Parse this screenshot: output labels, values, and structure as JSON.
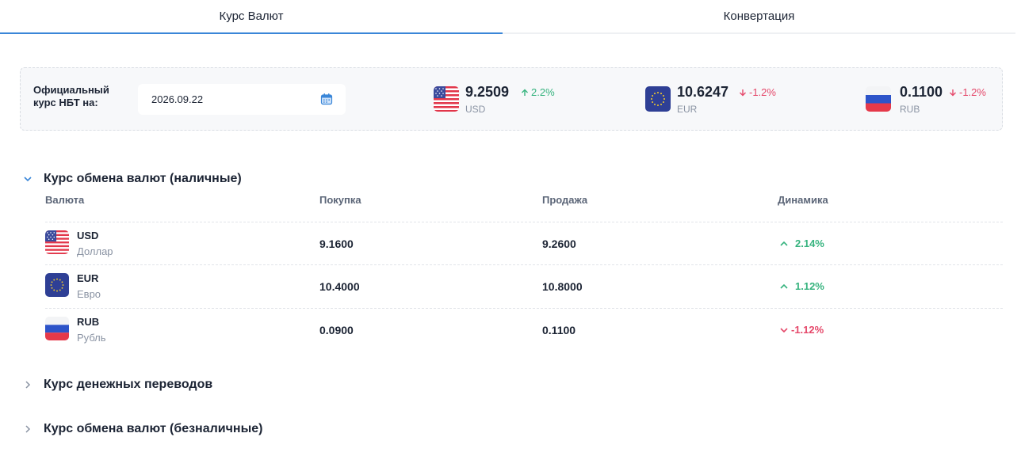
{
  "tabs": [
    {
      "label": "Курс Валют",
      "active": true
    },
    {
      "label": "Конвертация",
      "active": false
    }
  ],
  "official": {
    "label": "Официальный курс НБТ на:",
    "date": "2026.09.22",
    "date_icon": "calendar-icon",
    "rates": [
      {
        "value": "9.2509",
        "code": "USD",
        "change": "2.2%",
        "direction": "up",
        "flag": "us-flag-icon"
      },
      {
        "value": "10.6247",
        "code": "EUR",
        "change": "-1.2%",
        "direction": "down",
        "flag": "eu-flag-icon"
      },
      {
        "value": "0.1100",
        "code": "RUB",
        "change": "-1.2%",
        "direction": "down",
        "flag": "ru-flag-icon"
      }
    ]
  },
  "cash_section": {
    "title": "Курс обмена валют (наличные)",
    "expanded": true,
    "columns": [
      "Валюта",
      "Покупка",
      "Продажа",
      "Динамика"
    ],
    "rows": [
      {
        "code": "USD",
        "name": "Доллар",
        "buy": "9.1600",
        "sell": "9.2600",
        "dynamic": "2.14%",
        "direction": "up"
      },
      {
        "code": "EUR",
        "name": "Евро",
        "buy": "10.4000",
        "sell": "10.8000",
        "dynamic": "1.12%",
        "direction": "up"
      },
      {
        "code": "RUB",
        "name": "Рубль",
        "buy": "0.0900",
        "sell": "0.1100",
        "dynamic": "-1.12%",
        "direction": "down"
      }
    ]
  },
  "transfers_section": {
    "title": "Курс денежных переводов",
    "expanded": false
  },
  "noncash_section": {
    "title": "Курс обмена валют (безналичные)",
    "expanded": false
  },
  "colors": {
    "accent": "#3a86d8",
    "up": "#36b37e",
    "down": "#e5486a",
    "text": "#1c2434",
    "muted": "#8a93a3"
  }
}
